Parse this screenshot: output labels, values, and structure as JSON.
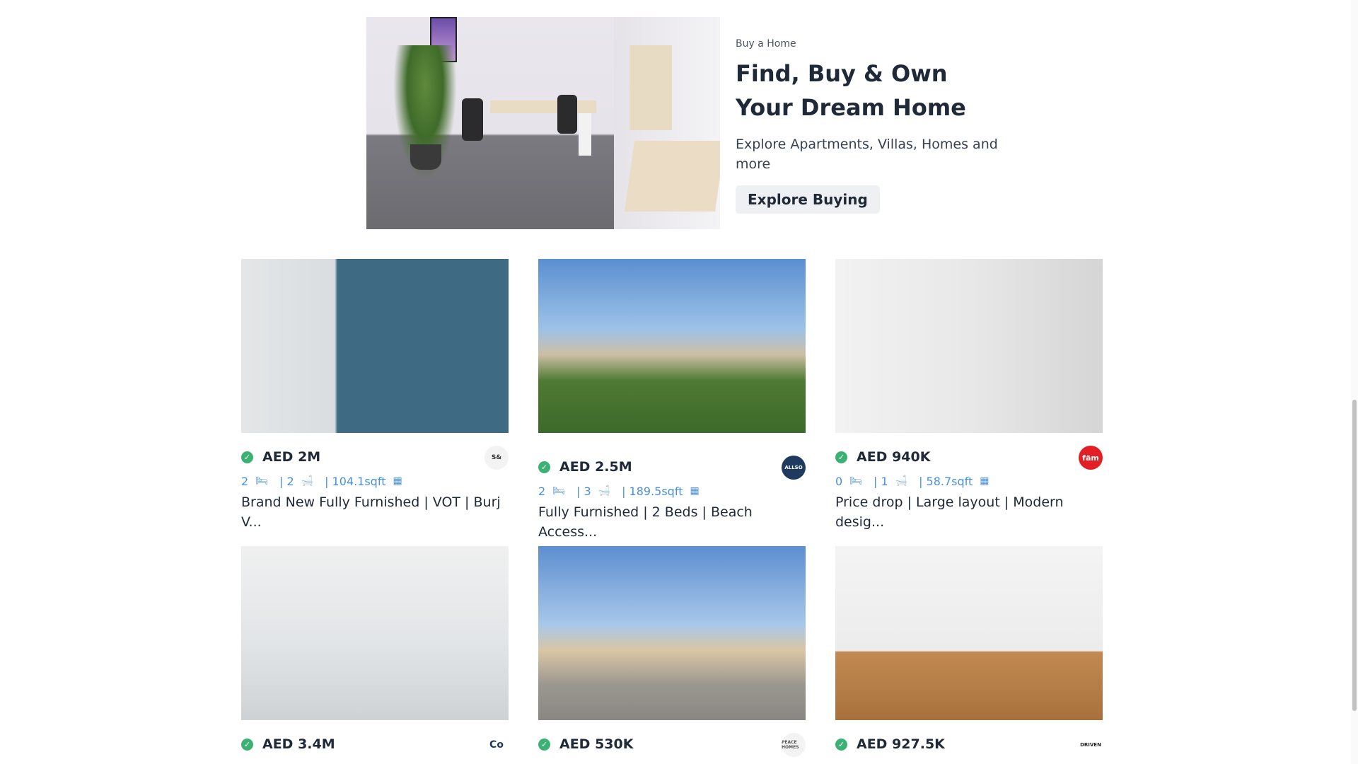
{
  "hero": {
    "kicker": "Buy a Home",
    "title": "Find, Buy & Own Your Dream Home",
    "subtitle": "Explore Apartments, Villas, Homes and more",
    "button": "Explore Buying"
  },
  "listings": [
    {
      "price": "AED 2M",
      "beds": "2",
      "baths": "| 2",
      "area": "| 104.1sqft",
      "title": "Brand New Fully Furnished | VOT | Burj V...",
      "agency_logo": "S&",
      "logo_color": "#333333"
    },
    {
      "price": "AED 2.5M",
      "beds": "2",
      "baths": "| 3",
      "area": "| 189.5sqft",
      "title": "Fully Furnished | 2 Beds | Beach Access...",
      "agency_logo": "ALLSO",
      "logo_color": "#1f3a5f"
    },
    {
      "price": "AED 940K",
      "beds": "0",
      "baths": "| 1",
      "area": "| 58.7sqft",
      "title": "Price drop | Large layout | Modern desig...",
      "agency_logo": "fäm",
      "logo_color": "#e31e24"
    },
    {
      "price": "AED 3.4M",
      "agency_logo": "Co",
      "logo_color": "#1f3a5f"
    },
    {
      "price": "AED 530K",
      "agency_logo": "PEACE HOMES",
      "logo_color": "#555555"
    },
    {
      "price": "AED 927.5K",
      "agency_logo": "DRIVEN",
      "logo_color": "#222222"
    }
  ],
  "icons": {
    "verified": "check-circle-icon",
    "bed": "bed-icon",
    "bath": "bath-icon",
    "area": "area-grid-icon"
  },
  "colors": {
    "verified": "#3bb273",
    "specs": "#4a90d9",
    "button_bg": "#eef0f4"
  }
}
